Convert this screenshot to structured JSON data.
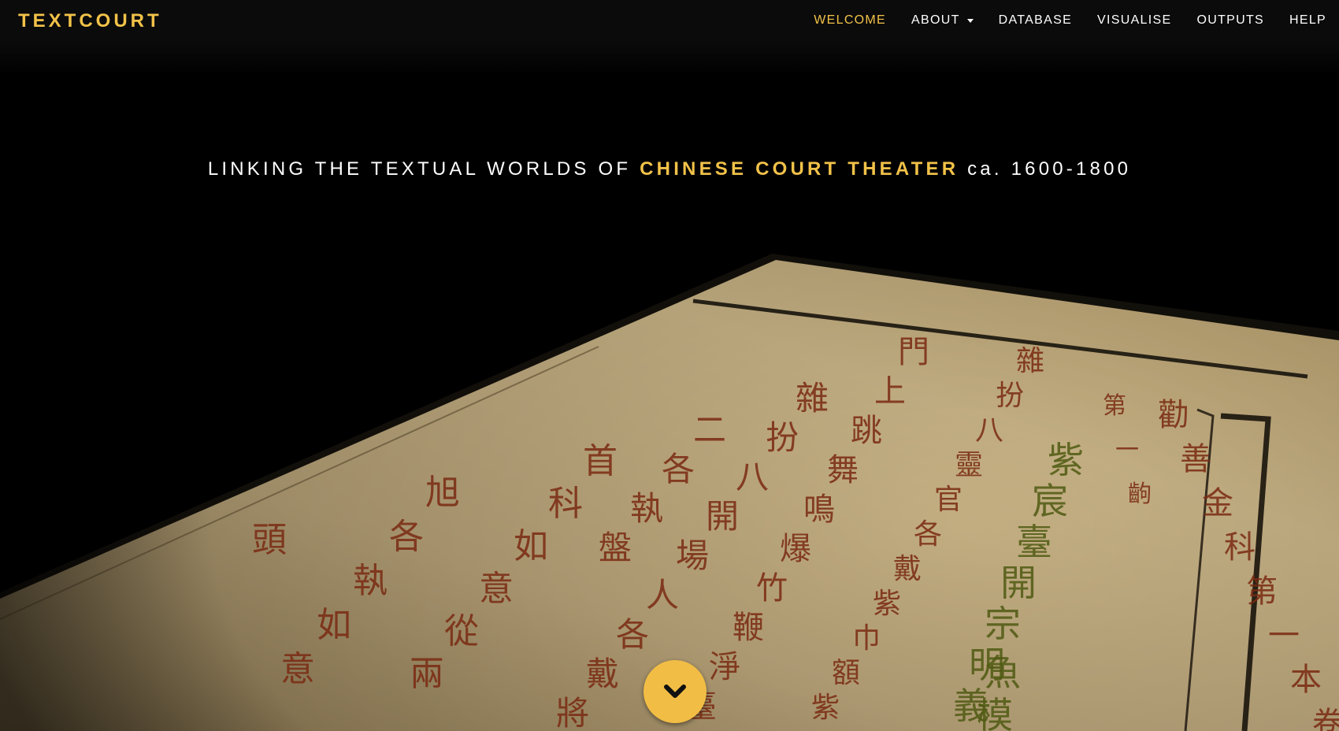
{
  "brand": {
    "name": "TEXTCOURT"
  },
  "nav": {
    "items": [
      {
        "label": "WELCOME",
        "active": true
      },
      {
        "label": "ABOUT",
        "dropdown": true
      },
      {
        "label": "DATABASE"
      },
      {
        "label": "VISUALISE"
      },
      {
        "label": "OUTPUTS"
      },
      {
        "label": "HELP"
      }
    ]
  },
  "hero": {
    "tagline_prefix": "LINKING THE TEXTUAL WORLDS OF",
    "tagline_highlight": "CHINESE COURT THEATER",
    "tagline_suffix": "ca. 1600-1800",
    "book_text": {
      "columns": [
        "勸善金科第一本卷上",
        "第一齣",
        "紫宸臺開宗明義",
        "雜扮八靈官各戴紫巾額紫蟒穿戰靴",
        "門上跳舞鳴爆竹鞭淨臺科仍",
        "雜扮八開場人各戴將",
        "二各執盤",
        "首科如意從兩",
        "旭各執如意",
        "頭",
        "魚模"
      ]
    },
    "scroll_button": {
      "icon": "chevron-down-icon"
    }
  },
  "colors": {
    "accent": "#f2c249",
    "nav_bg": "#0b0b0b",
    "hero_bg": "#000000",
    "page_paper": "#c3ad82",
    "ink_red": "#7a2a12",
    "ink_green": "#4f5a12"
  }
}
